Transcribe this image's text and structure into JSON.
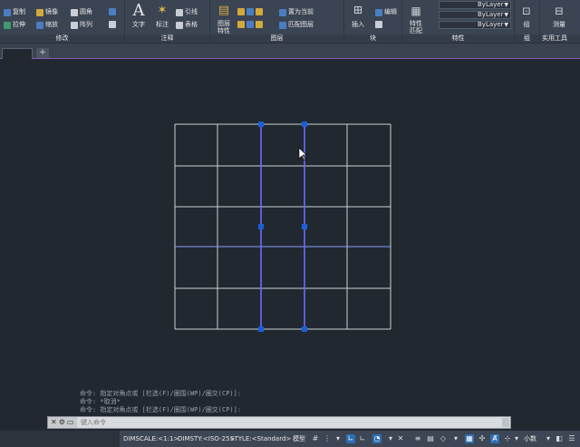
{
  "ribbon": {
    "modify": {
      "title": "修改",
      "items": [
        "复制",
        "镜像",
        "圆角",
        "拉伸",
        "缩放",
        "阵列"
      ]
    },
    "annotation": {
      "title": "注释",
      "text_label": "文字",
      "dim_label": "标注",
      "leader_label": "引线",
      "table_label": "表格"
    },
    "layers": {
      "title": "图层",
      "layer_props_label": "图层特性",
      "set_current_label": "置为当前",
      "match_layer_label": "匹配图层"
    },
    "block": {
      "title": "块",
      "insert_label": "插入",
      "edit_label": "编辑"
    },
    "properties": {
      "title": "特性",
      "match_label": "特性匹配",
      "bylayer_1": "ByLayer",
      "bylayer_2": "ByLayer",
      "bylayer_3": "ByLayer"
    },
    "groups": {
      "title": "组",
      "group_label": "组"
    },
    "utilities": {
      "title": "实用工具",
      "measure_label": "测量"
    }
  },
  "tabs": {
    "new_tab": "+"
  },
  "command_history": [
    "命令: 指定对角点或 [栏选(F)/圈围(WP)/圈交(CP)]:",
    "命令: *取消*",
    "命令: 指定对角点或 [栏选(F)/圈围(WP)/圈交(CP)]:"
  ],
  "command_line": {
    "placeholder": "键入命令"
  },
  "status_bar": {
    "dimscale": "DIMSCALE:<1:1>",
    "dimsty": "DIMSTY:<ISO-25>",
    "style": "STYLE:<Standard>",
    "model_label": "模型",
    "units_label": "小数"
  },
  "colors": {
    "grid_line": "#c6d3cf",
    "selected_line": "#6b6bff",
    "grip": "#1b5fd8",
    "background": "#212830"
  }
}
